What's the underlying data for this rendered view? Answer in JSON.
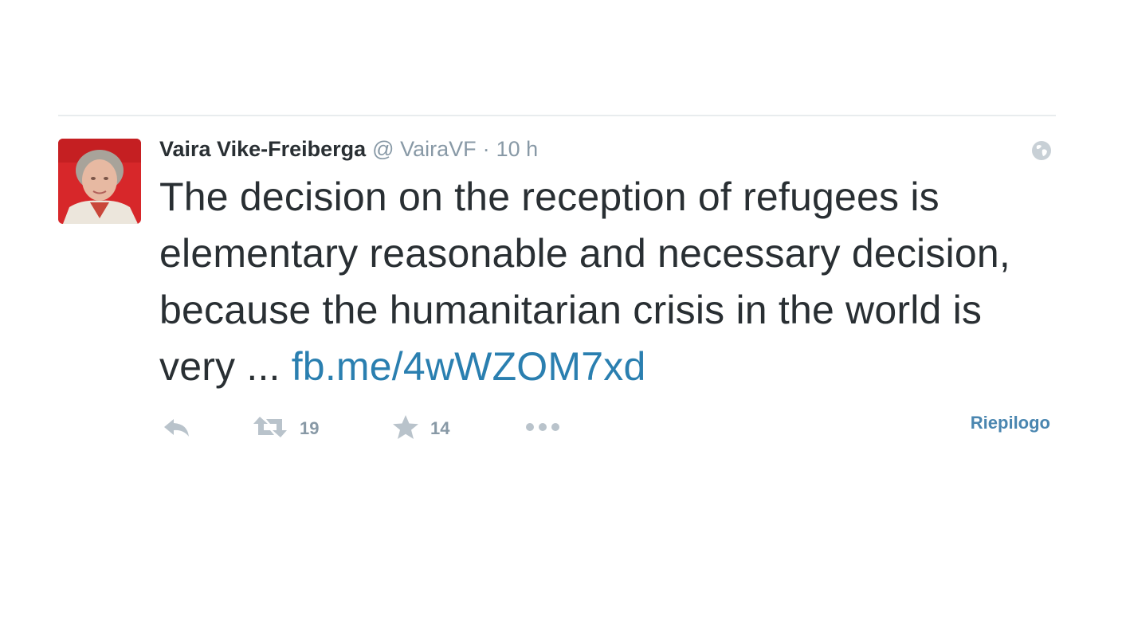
{
  "tweet": {
    "author_name": "Vaira Vike-Freiberga",
    "handle": "@ VairaVF",
    "separator": "·",
    "time": "10 h",
    "text": "The decision on the reception of refugees is elementary reasonable and necessary decision, because the humanitarian crisis in the world is very ...",
    "link": "fb.me/4wWZOM7xd",
    "retweet_count": "19",
    "favorite_count": "14",
    "summary_label": "Riepilogo"
  },
  "icons": {
    "privacy": "globe-icon",
    "reply": "reply-icon",
    "retweet": "retweet-icon",
    "favorite": "star-icon",
    "more": "more-icon"
  },
  "colors": {
    "text": "#292f33",
    "muted": "#8899a6",
    "link": "#2a7fb0",
    "icon": "#b9c3cb",
    "divider": "#e8ecee"
  }
}
